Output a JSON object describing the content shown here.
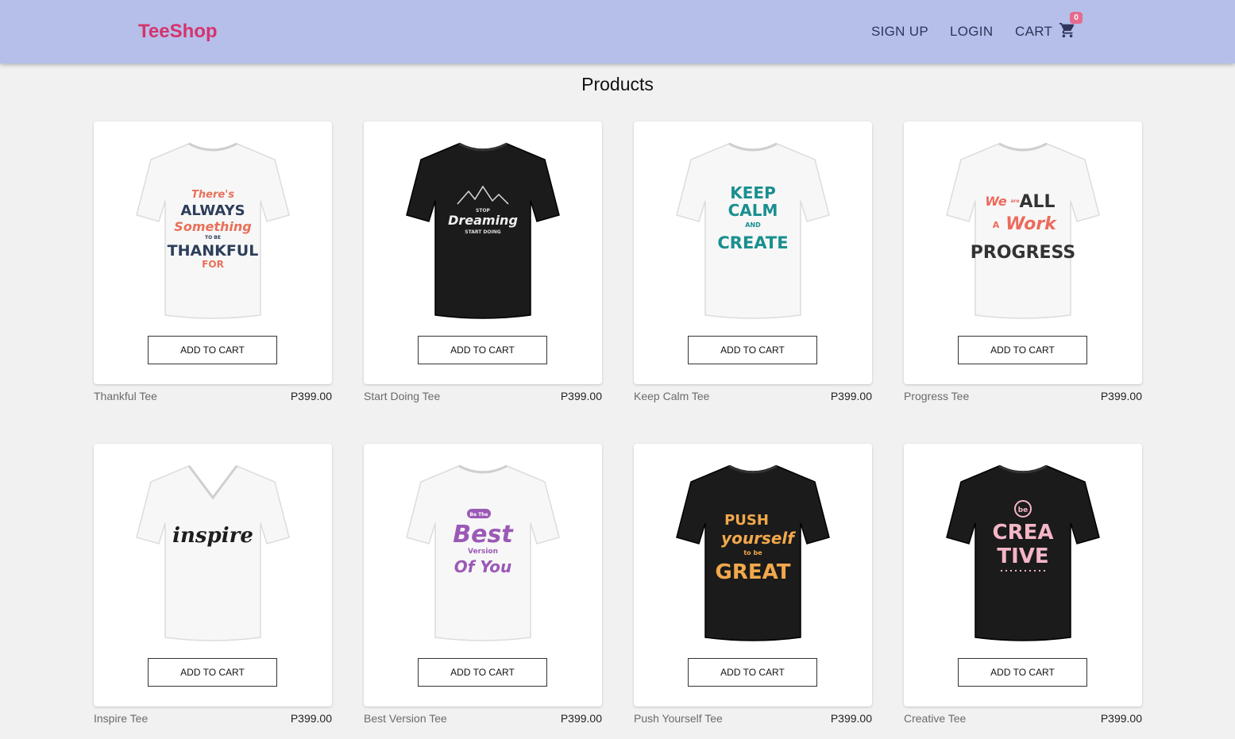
{
  "brand": "TeeShop",
  "nav": {
    "signup": "SIGN UP",
    "login": "LOGIN",
    "cart": "CART",
    "cart_count": "0"
  },
  "page_title": "Products",
  "colors": {
    "navbar": "#b5bfea",
    "brand": "#d6336c",
    "badge": "#e56b8f",
    "background": "#f1f1f1"
  },
  "products": [
    {
      "name": "Thankful Tee",
      "price": "P399.00",
      "button": "ADD TO CART",
      "shirt_color": "white",
      "print": [
        "There's",
        "ALWAYS",
        "Something",
        "TO BE",
        "THANKFUL",
        "FOR"
      ]
    },
    {
      "name": "Start Doing Tee",
      "price": "P399.00",
      "button": "ADD TO CART",
      "shirt_color": "black",
      "print": [
        "STOP",
        "Dreaming",
        "START DOING"
      ]
    },
    {
      "name": "Keep Calm Tee",
      "price": "P399.00",
      "button": "ADD TO CART",
      "shirt_color": "white",
      "print": [
        "KEEP",
        "CALM",
        "AND",
        "CREATE"
      ]
    },
    {
      "name": "Progress Tee",
      "price": "P399.00",
      "button": "ADD TO CART",
      "shirt_color": "white",
      "print": [
        "We",
        "are",
        "ALL",
        "A",
        "Work",
        "PROGRESS"
      ]
    },
    {
      "name": "Inspire Tee",
      "price": "P399.00",
      "button": "ADD TO CART",
      "shirt_color": "white",
      "print": [
        "inspire"
      ]
    },
    {
      "name": "Best Version Tee",
      "price": "P399.00",
      "button": "ADD TO CART",
      "shirt_color": "white",
      "print": [
        "Be The",
        "Best",
        "Version",
        "Of You"
      ]
    },
    {
      "name": "Push Yourself Tee",
      "price": "P399.00",
      "button": "ADD TO CART",
      "shirt_color": "black",
      "print": [
        "PUSH",
        "yourself",
        "to be",
        "GREAT"
      ]
    },
    {
      "name": "Creative Tee",
      "price": "P399.00",
      "button": "ADD TO CART",
      "shirt_color": "black",
      "print": [
        "be",
        "CREA",
        "TIVE"
      ]
    }
  ]
}
